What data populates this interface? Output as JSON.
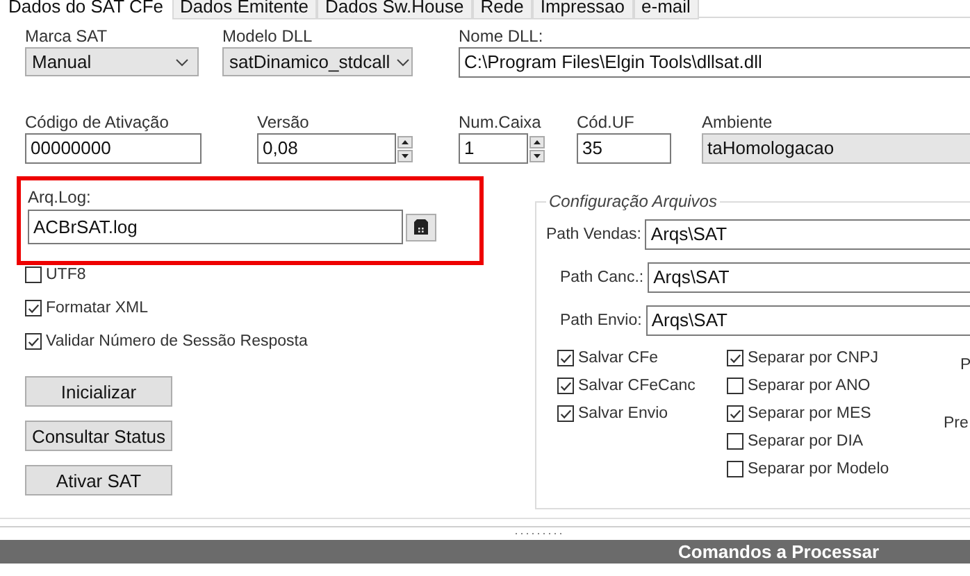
{
  "tabs": [
    {
      "label": "Dados do SAT CFe",
      "selected": true
    },
    {
      "label": "Dados Emitente",
      "selected": false
    },
    {
      "label": "Dados Sw.House",
      "selected": false
    },
    {
      "label": "Rede",
      "selected": false
    },
    {
      "label": "Impressao",
      "selected": false
    },
    {
      "label": "e-mail",
      "selected": false
    }
  ],
  "row_1": [
    {
      "kind": "combo",
      "label": "Marca SAT",
      "value": "Manual"
    },
    {
      "kind": "combo",
      "label": "Modelo DLL",
      "value": "satDinamico_stdcall"
    },
    {
      "kind": "text",
      "label": "Nome DLL:",
      "value": "C:\\Program Files\\Elgin Tools\\dllsat.dll"
    }
  ],
  "row_2": [
    {
      "kind": "text",
      "label": "Código de Ativação",
      "value": "00000000"
    },
    {
      "kind": "spin",
      "label": "Versão",
      "value": "0,08"
    },
    {
      "kind": "spin",
      "label": "Num.Caixa",
      "value": "1"
    },
    {
      "kind": "text",
      "label": "Cód.UF",
      "value": "35"
    },
    {
      "kind": "readonly",
      "label": "Ambiente",
      "value": "taHomologacao"
    }
  ],
  "arq_log": {
    "label": "Arq.Log:",
    "value": "ACBrSAT.log",
    "highlighted": true
  },
  "options": [
    {
      "label": "UTF8",
      "checked": false
    },
    {
      "label": "Formatar XML",
      "checked": true
    },
    {
      "label": "Validar Número de Sessão Resposta",
      "checked": true
    }
  ],
  "buttons": [
    "Inicializar",
    "Consultar Status",
    "Ativar SAT"
  ],
  "config_arquivos": {
    "title": "Configuração Arquivos",
    "paths": [
      {
        "label": "Path Vendas:",
        "value": "Arqs\\SAT"
      },
      {
        "label": "Path Canc.:",
        "value": "Arqs\\SAT"
      },
      {
        "label": "Path Envio:",
        "value": "Arqs\\SAT"
      }
    ],
    "save_options": [
      {
        "label": "Salvar CFe",
        "checked": true
      },
      {
        "label": "Salvar CFeCanc",
        "checked": true
      },
      {
        "label": "Salvar Envio",
        "checked": true
      }
    ],
    "separate_options": [
      {
        "label": "Separar por CNPJ",
        "checked": true
      },
      {
        "label": "Separar por ANO",
        "checked": false
      },
      {
        "label": "Separar por MES",
        "checked": true
      },
      {
        "label": "Separar por DIA",
        "checked": false
      },
      {
        "label": "Separar por Modelo",
        "checked": false
      }
    ],
    "cut_labels": [
      "P",
      "Pre"
    ]
  },
  "bottom_panel": {
    "title": "Comandos a Processar"
  }
}
